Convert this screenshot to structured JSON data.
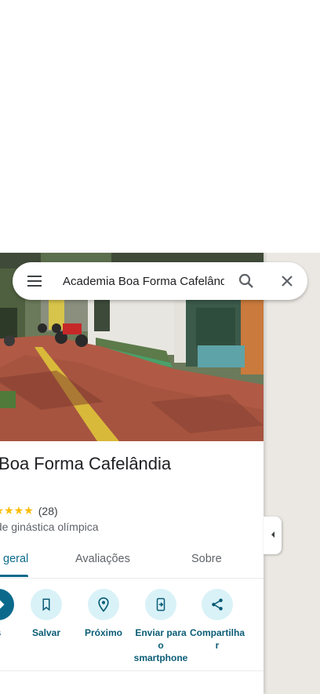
{
  "search": {
    "value": "Academia Boa Forma Cafelândia",
    "menu_icon": "menu-icon",
    "search_icon": "search-icon",
    "close_icon": "close-icon"
  },
  "place": {
    "name": "demia Boa Forma Cafelândia\ná",
    "rating_stars": "★★★★★",
    "review_count": "(28)",
    "category": "ia de ginástica olímpica"
  },
  "tabs": [
    {
      "label": "geral"
    },
    {
      "label": "Avaliações"
    },
    {
      "label": "Sobre"
    }
  ],
  "actions": [
    {
      "label": "s",
      "icon": "directions-icon"
    },
    {
      "label": "Salvar",
      "icon": "bookmark-icon"
    },
    {
      "label": "Próximo",
      "icon": "nearby-icon"
    },
    {
      "label": "Enviar para\no\nsmartphone",
      "icon": "send-to-phone-icon"
    },
    {
      "label": "Compartilha\nr",
      "icon": "share-icon"
    }
  ],
  "colors": {
    "accent": "#0b6a8c",
    "action_bg": "#d9f2f8",
    "star": "#fbbc04",
    "map_bg": "#ebe8e3"
  },
  "collapse_icon": "chevron-left-icon"
}
